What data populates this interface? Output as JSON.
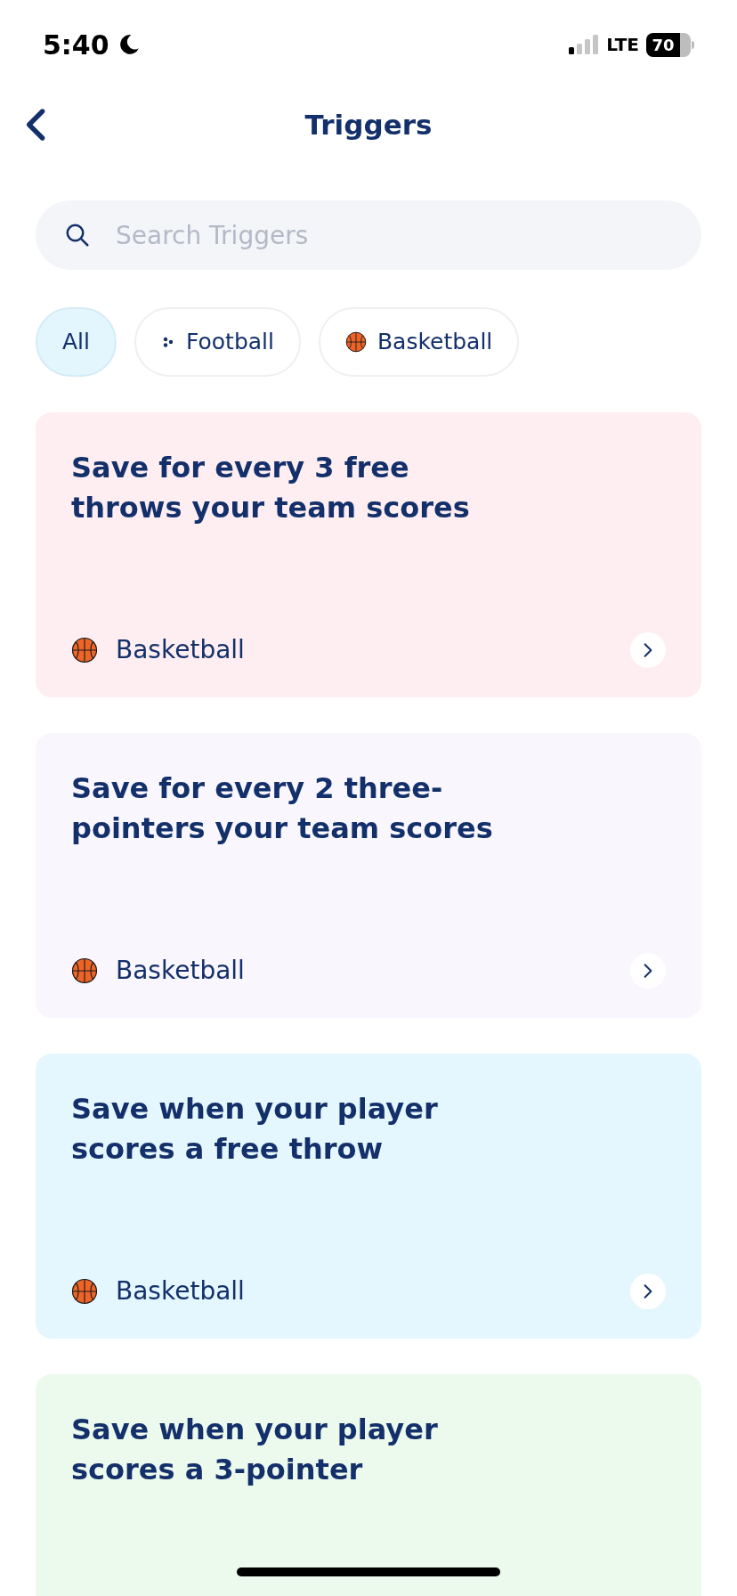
{
  "status_bar": {
    "time": "5:40",
    "network": "LTE",
    "battery": "70"
  },
  "header": {
    "title": "Triggers"
  },
  "search": {
    "placeholder": "Search Triggers"
  },
  "filters": [
    {
      "label": "All",
      "kind": "none",
      "selected": true
    },
    {
      "label": "Football",
      "kind": "football",
      "selected": false
    },
    {
      "label": "Basketball",
      "kind": "basketball",
      "selected": false
    }
  ],
  "triggers": [
    {
      "title": "Save for every 3 free throws your team scores",
      "sport": "Basketball",
      "kind": "basketball",
      "color": "#feeef1"
    },
    {
      "title": "Save for every 2 three-pointers your team scores",
      "sport": "Basketball",
      "kind": "basketball",
      "color": "#f9f6fd"
    },
    {
      "title": "Save when your player scores a free throw",
      "sport": "Basketball",
      "kind": "basketball",
      "color": "#e5f7fe"
    },
    {
      "title": "Save when your player scores a 3-pointer",
      "color": "#ecf9ed"
    }
  ]
}
